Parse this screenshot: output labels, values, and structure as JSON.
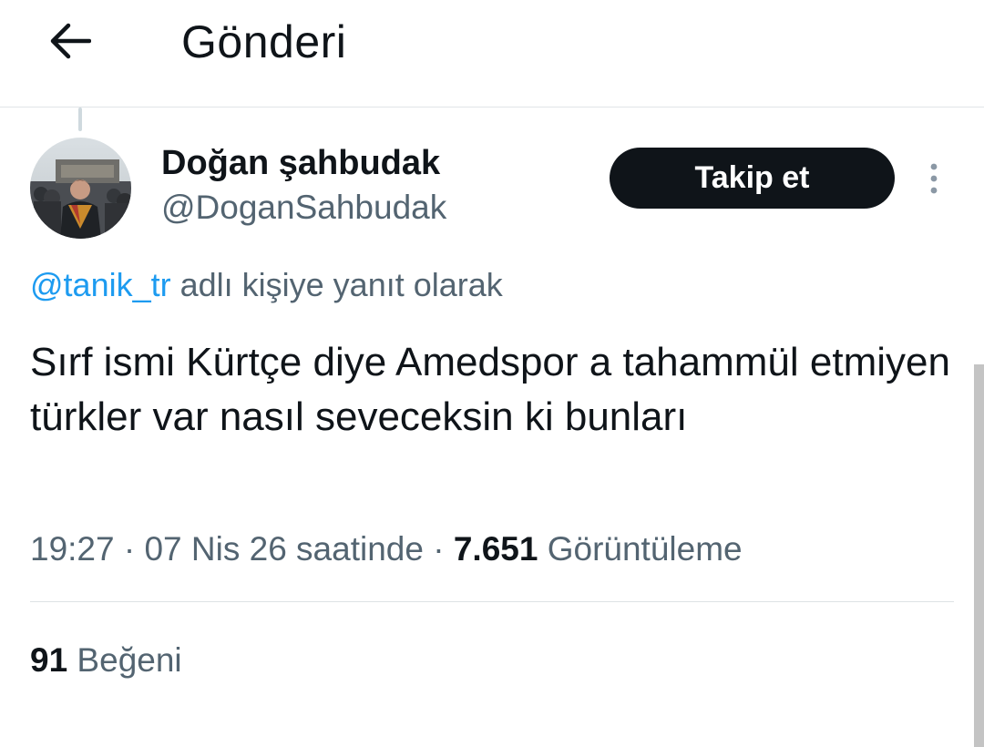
{
  "header": {
    "title": "Gönderi",
    "back_icon": "arrow-left-icon"
  },
  "tweet": {
    "author": {
      "name": "Doğan şahbudak",
      "handle": "@DoganSahbudak"
    },
    "follow_label": "Takip et",
    "more_icon": "more-vertical-icon",
    "reply_context": {
      "mention": "@tanik_tr",
      "suffix": " adlı kişiye yanıt olarak"
    },
    "text": "Sırf ismi Kürtçe diye Amedspor a tahammül etmiyen türkler var nasıl seveceksin ki bunları",
    "time": "19:27 · 07 Nis 26 saatinde",
    "separator": " · ",
    "views_count": "7.651",
    "views_label": " Görüntüleme",
    "likes_count": "91",
    "likes_label": " Beğeni"
  },
  "colors": {
    "text_primary": "#0f1419",
    "text_secondary": "#536471",
    "link": "#1d9bf0",
    "button_bg": "#0f1419",
    "button_text": "#ffffff",
    "border": "#e1e5e8"
  }
}
